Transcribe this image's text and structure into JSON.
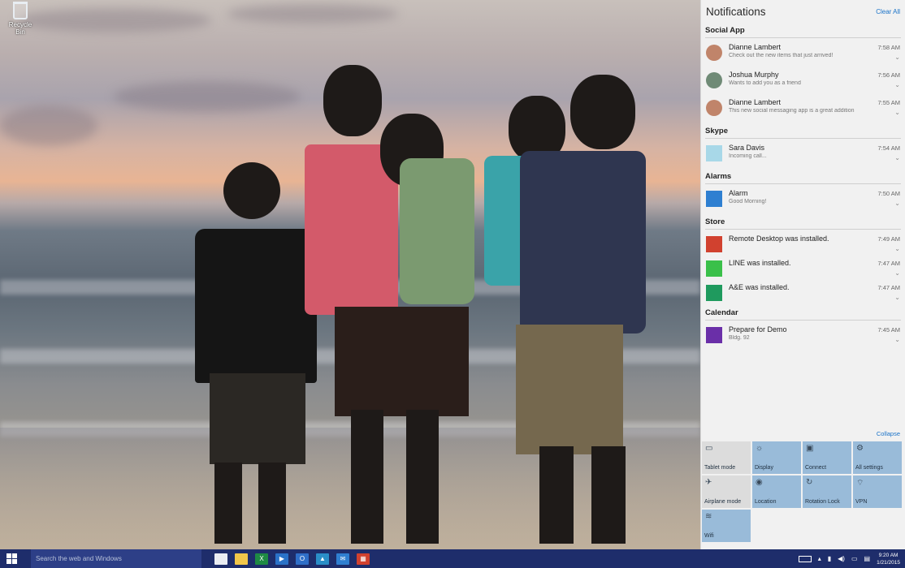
{
  "desktop": {
    "recycle_bin_label": "Recycle Bin"
  },
  "action_center": {
    "title": "Notifications",
    "clear_all": "Clear All",
    "collapse": "Collapse",
    "groups": [
      {
        "name": "Social App",
        "items": [
          {
            "title": "Dianne Lambert",
            "body": "Check out the new items that just arrived!",
            "time": "7:58 AM",
            "icon": "avatar-icon",
            "color": "#c0846a"
          },
          {
            "title": "Joshua Murphy",
            "body": "Wants to add you as a friend",
            "time": "7:56 AM",
            "icon": "avatar-icon",
            "color": "#6f8a76"
          },
          {
            "title": "Dianne Lambert",
            "body": "This new social messaging app is a great addition",
            "time": "7:55 AM",
            "icon": "avatar-icon",
            "color": "#c0846a"
          }
        ]
      },
      {
        "name": "Skype",
        "items": [
          {
            "title": "Sara Davis",
            "body": "Incoming call...",
            "time": "7:54 AM",
            "icon": "skype-icon",
            "color": "#a8d8e8"
          }
        ]
      },
      {
        "name": "Alarms",
        "items": [
          {
            "title": "Alarm",
            "body": "Good Morning!",
            "time": "7:50 AM",
            "icon": "alarm-clock-icon",
            "color": "#2e7fd1"
          }
        ]
      },
      {
        "name": "Store",
        "items": [
          {
            "title": "Remote Desktop was installed.",
            "body": "",
            "time": "7:49 AM",
            "icon": "remote-desktop-icon",
            "color": "#d1412f"
          },
          {
            "title": "LINE was installed.",
            "body": "",
            "time": "7:47 AM",
            "icon": "line-icon",
            "color": "#3ac04a"
          },
          {
            "title": "A&E was installed.",
            "body": "",
            "time": "7:47 AM",
            "icon": "ae-icon",
            "color": "#1f9a5e"
          }
        ]
      },
      {
        "name": "Calendar",
        "items": [
          {
            "title": "Prepare for Demo",
            "body": "Bldg. 92",
            "time": "7:45 AM",
            "icon": "calendar-icon",
            "color": "#6a2fa8"
          }
        ]
      }
    ],
    "quick_actions": [
      {
        "label": "Tablet mode",
        "icon": "tablet-icon",
        "glyph": "▭",
        "on": false
      },
      {
        "label": "Display",
        "icon": "display-icon",
        "glyph": "☼",
        "on": true
      },
      {
        "label": "Connect",
        "icon": "connect-icon",
        "glyph": "▣",
        "on": true
      },
      {
        "label": "All settings",
        "icon": "gear-icon",
        "glyph": "⚙",
        "on": true
      },
      {
        "label": "Airplane mode",
        "icon": "airplane-icon",
        "glyph": "✈",
        "on": false
      },
      {
        "label": "Location",
        "icon": "location-icon",
        "glyph": "◉",
        "on": true
      },
      {
        "label": "Rotation Lock",
        "icon": "rotation-lock-icon",
        "glyph": "↻",
        "on": true
      },
      {
        "label": "VPN",
        "icon": "vpn-icon",
        "glyph": "⌔",
        "on": true
      },
      {
        "label": "Wifi",
        "icon": "wifi-icon",
        "glyph": "≋",
        "on": true
      }
    ]
  },
  "taskbar": {
    "search_placeholder": "Search the web and Windows",
    "apps": [
      {
        "icon": "task-view-icon",
        "color": "#e9ecf2",
        "glyph": ""
      },
      {
        "icon": "file-explorer-icon",
        "color": "#f1c64a",
        "glyph": ""
      },
      {
        "icon": "excel-icon",
        "color": "#1e8a44",
        "glyph": "X"
      },
      {
        "icon": "powerpoint-icon",
        "color": "#2a72c8",
        "glyph": "▶"
      },
      {
        "icon": "outlook-icon",
        "color": "#2f6fc8",
        "glyph": "O"
      },
      {
        "icon": "photos-icon",
        "color": "#2a8ec8",
        "glyph": "▲"
      },
      {
        "icon": "mail-icon",
        "color": "#2f7fd1",
        "glyph": "✉"
      },
      {
        "icon": "store-icon",
        "color": "#d1412f",
        "glyph": "▦"
      }
    ],
    "clock_time": "9:20 AM",
    "clock_date": "1/21/2015"
  }
}
